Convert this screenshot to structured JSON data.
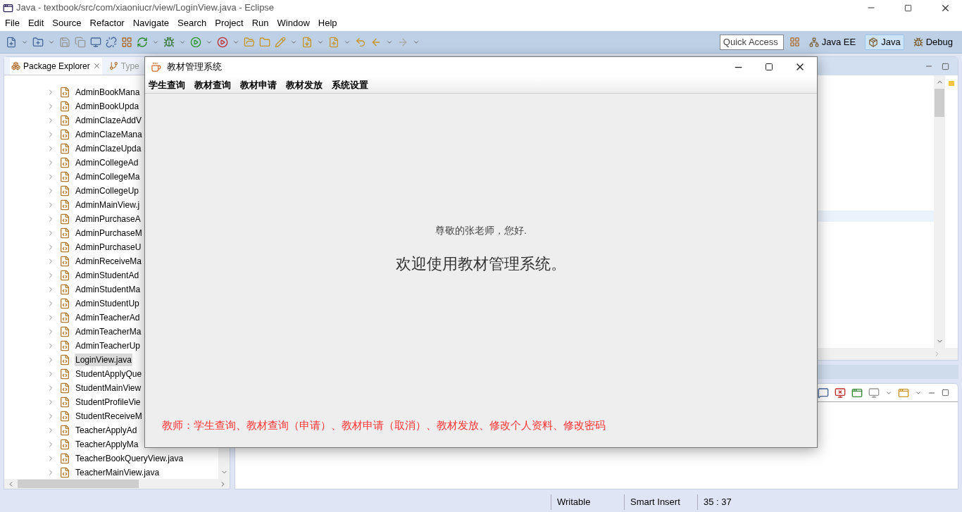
{
  "window": {
    "title": "Java - textbook/src/com/xiaoniucr/view/LoginView.java - Eclipse"
  },
  "menu": [
    "File",
    "Edit",
    "Source",
    "Refactor",
    "Navigate",
    "Search",
    "Project",
    "Run",
    "Window",
    "Help"
  ],
  "quick_access": {
    "placeholder": "Quick Access"
  },
  "perspectives": [
    {
      "label": "Java EE",
      "selected": false
    },
    {
      "label": "Java",
      "selected": true
    },
    {
      "label": "Debug",
      "selected": false
    }
  ],
  "package_explorer": {
    "tabs": [
      {
        "label": "Package Explorer",
        "selected": true
      },
      {
        "label": "Type",
        "selected": false
      }
    ],
    "items": [
      {
        "label": "AdminBookMana",
        "selected": false
      },
      {
        "label": "AdminBookUpda",
        "selected": false
      },
      {
        "label": "AdminClazeAddV",
        "selected": false
      },
      {
        "label": "AdminClazeMana",
        "selected": false
      },
      {
        "label": "AdminClazeUpda",
        "selected": false
      },
      {
        "label": "AdminCollegeAd",
        "selected": false
      },
      {
        "label": "AdminCollegeMa",
        "selected": false
      },
      {
        "label": "AdminCollegeUp",
        "selected": false
      },
      {
        "label": "AdminMainView.j",
        "selected": false
      },
      {
        "label": "AdminPurchaseA",
        "selected": false
      },
      {
        "label": "AdminPurchaseM",
        "selected": false
      },
      {
        "label": "AdminPurchaseU",
        "selected": false
      },
      {
        "label": "AdminReceiveMa",
        "selected": false
      },
      {
        "label": "AdminStudentAd",
        "selected": false
      },
      {
        "label": "AdminStudentMa",
        "selected": false
      },
      {
        "label": "AdminStudentUp",
        "selected": false
      },
      {
        "label": "AdminTeacherAd",
        "selected": false
      },
      {
        "label": "AdminTeacherMa",
        "selected": false
      },
      {
        "label": "AdminTeacherUp",
        "selected": false
      },
      {
        "label": "LoginView.java",
        "selected": true
      },
      {
        "label": "StudentApplyQue",
        "selected": false
      },
      {
        "label": "StudentMainView",
        "selected": false
      },
      {
        "label": "StudentProfileVie",
        "selected": false
      },
      {
        "label": "StudentReceiveM",
        "selected": false
      },
      {
        "label": "TeacherApplyAd",
        "selected": false
      },
      {
        "label": "TeacherApplyMa",
        "selected": false
      },
      {
        "label": "TeacherBookQueryView.java",
        "selected": false
      },
      {
        "label": "TeacherMainView.java",
        "selected": false
      }
    ]
  },
  "dialog": {
    "title": "教材管理系统",
    "menu": [
      "学生查询",
      "教材查询",
      "教材申请",
      "教材发放",
      "系统设置"
    ],
    "greeting": "尊敬的张老师，您好.",
    "welcome": "欢迎使用教材管理系统。",
    "note": "教师：学生查询、教材查询（申请）、教材申请（取消）、教材发放、修改个人资料、修改密码"
  },
  "status_bar": [
    "Writable",
    "Smart Insert",
    "35 : 37"
  ]
}
